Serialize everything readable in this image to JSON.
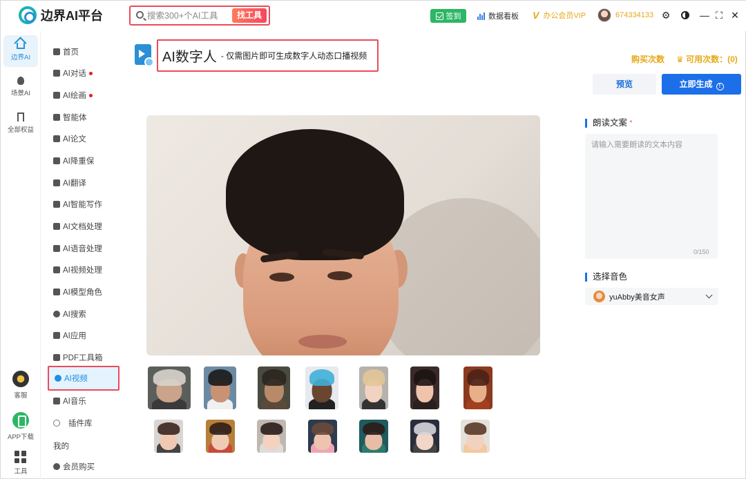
{
  "app": {
    "brand": "边界AI平台",
    "search_placeholder": "搜索300+个AI工具",
    "search_button": "找工具",
    "signin": "签到",
    "dashboard": "数据看板",
    "vip": "办公会员VIP",
    "user_id": "674334133"
  },
  "rail": {
    "items": [
      {
        "label": "边界AI",
        "icon": "home-icon"
      },
      {
        "label": "场景AI",
        "icon": "bulb-icon"
      },
      {
        "label": "全部权益",
        "icon": "bookmark-icon"
      }
    ],
    "bottom": [
      {
        "label": "客服",
        "icon": "customer-service-icon"
      },
      {
        "label": "APP下载",
        "icon": "app-download-icon"
      },
      {
        "label": "工具",
        "icon": "tools-grid-icon"
      }
    ]
  },
  "menu": {
    "items": [
      {
        "label": "首页",
        "icon": "home-icon"
      },
      {
        "label": "AI对话",
        "icon": "cube-icon",
        "dot": true
      },
      {
        "label": "AI绘画",
        "icon": "image-icon",
        "dot": true
      },
      {
        "label": "智能体",
        "icon": "robot-icon"
      },
      {
        "label": "AI论文",
        "icon": "document-icon"
      },
      {
        "label": "AI降重保",
        "icon": "list-icon"
      },
      {
        "label": "AI翻译",
        "icon": "translate-icon"
      },
      {
        "label": "AI智能写作",
        "icon": "pen-icon"
      },
      {
        "label": "AI文档处理",
        "icon": "text-doc-icon"
      },
      {
        "label": "AI语音处理",
        "icon": "speaker-icon"
      },
      {
        "label": "AI视频处理",
        "icon": "video-icon"
      },
      {
        "label": "AI模型角色",
        "icon": "model-icon"
      },
      {
        "label": "AI搜索",
        "icon": "search-icon"
      },
      {
        "label": "AI应用",
        "icon": "apps-icon"
      },
      {
        "label": "PDF工具箱",
        "icon": "wrench-icon"
      },
      {
        "label": "AI视频",
        "icon": "play-icon",
        "active": true
      },
      {
        "label": "AI音乐",
        "icon": "music-icon"
      },
      {
        "label": "插件库",
        "icon": "plugin-icon"
      }
    ],
    "section_mine": "我的",
    "member_buy": "会员购买"
  },
  "main": {
    "title": "AI数字人",
    "subtitle": "- 仅需图片即可生成数字人动态口播视频",
    "buy_times": "购买次数",
    "available_times": "可用次数：(0)",
    "preview_button": "预览",
    "generate_button": "立即生成"
  },
  "right": {
    "script_title": "朗读文案",
    "script_required": "*",
    "script_placeholder": "请输入需要朗读的文本内容",
    "counter": "0/150",
    "voice_title": "选择音色",
    "voice_value": "yuAbby美音女声"
  },
  "thumbs": [
    {
      "name": "old-man-avatar",
      "bg": "#5b5f5c",
      "skin": "#c9a48a",
      "hair": "#d8d4cc",
      "body": "#3a3a3a"
    },
    {
      "name": "man-sunglasses-avatar",
      "bg": "#6d8aa3",
      "skin": "#c99275",
      "hair": "#1a1a1a",
      "body": "#f0f0f0"
    },
    {
      "name": "pirate-man-avatar",
      "bg": "#4b4a3e",
      "skin": "#b88a6a",
      "hair": "#2a2620",
      "body": "#5a4a3a"
    },
    {
      "name": "colorful-hair-avatar",
      "bg": "#e6e9ee",
      "skin": "#6a4530",
      "hair": "#3fb0d8",
      "body": "#222"
    },
    {
      "name": "blonde-girl-avatar",
      "bg": "#b5b2ad",
      "skin": "#f2d2c0",
      "hair": "#e2c597",
      "body": "#333"
    },
    {
      "name": "dark-hair-girl-avatar",
      "bg": "#3a2a2a",
      "skin": "#efc4ad",
      "hair": "#1c1413",
      "body": "#2a1f1f"
    },
    {
      "name": "warm-girl-avatar",
      "bg": "#8a3a1f",
      "skin": "#e7b08b",
      "hair": "#4a2216",
      "body": "#a04020"
    },
    {
      "name": "woman-portrait-avatar",
      "bg": "#d9d5d0",
      "skin": "#efc9b3",
      "hair": "#3a2620",
      "body": "#444"
    },
    {
      "name": "city-girl-avatar",
      "bg": "#b77f3a",
      "skin": "#f0cbb4",
      "hair": "#2e1f1a",
      "body": "#c84a3a"
    },
    {
      "name": "long-hair-girl-avatar",
      "bg": "#bfb8b1",
      "skin": "#f3d2c0",
      "hair": "#2b1d19",
      "body": "#ddd"
    },
    {
      "name": "neon-girl-avatar",
      "bg": "#2d3b4e",
      "skin": "#eec4b0",
      "hair": "#6a4a3a",
      "body": "#f0a5b5"
    },
    {
      "name": "teal-girl-avatar",
      "bg": "#1e5a5e",
      "skin": "#e8bda6",
      "hair": "#2a1c18",
      "body": "#2f7a6f"
    },
    {
      "name": "silver-hair-girl-avatar",
      "bg": "#2a2e3a",
      "skin": "#f2d6c8",
      "hair": "#d4d6dc",
      "body": "#444"
    },
    {
      "name": "ponytail-girl-avatar",
      "bg": "#e4e0dc",
      "skin": "#f2d2be",
      "hair": "#5a3a28",
      "body": "#f4c8a0"
    }
  ],
  "colors": {
    "accent": "#1c6fe8",
    "highlight_box": "#e94b5a",
    "gold": "#e6a817",
    "active_menu_bg": "#e4f3fd"
  }
}
